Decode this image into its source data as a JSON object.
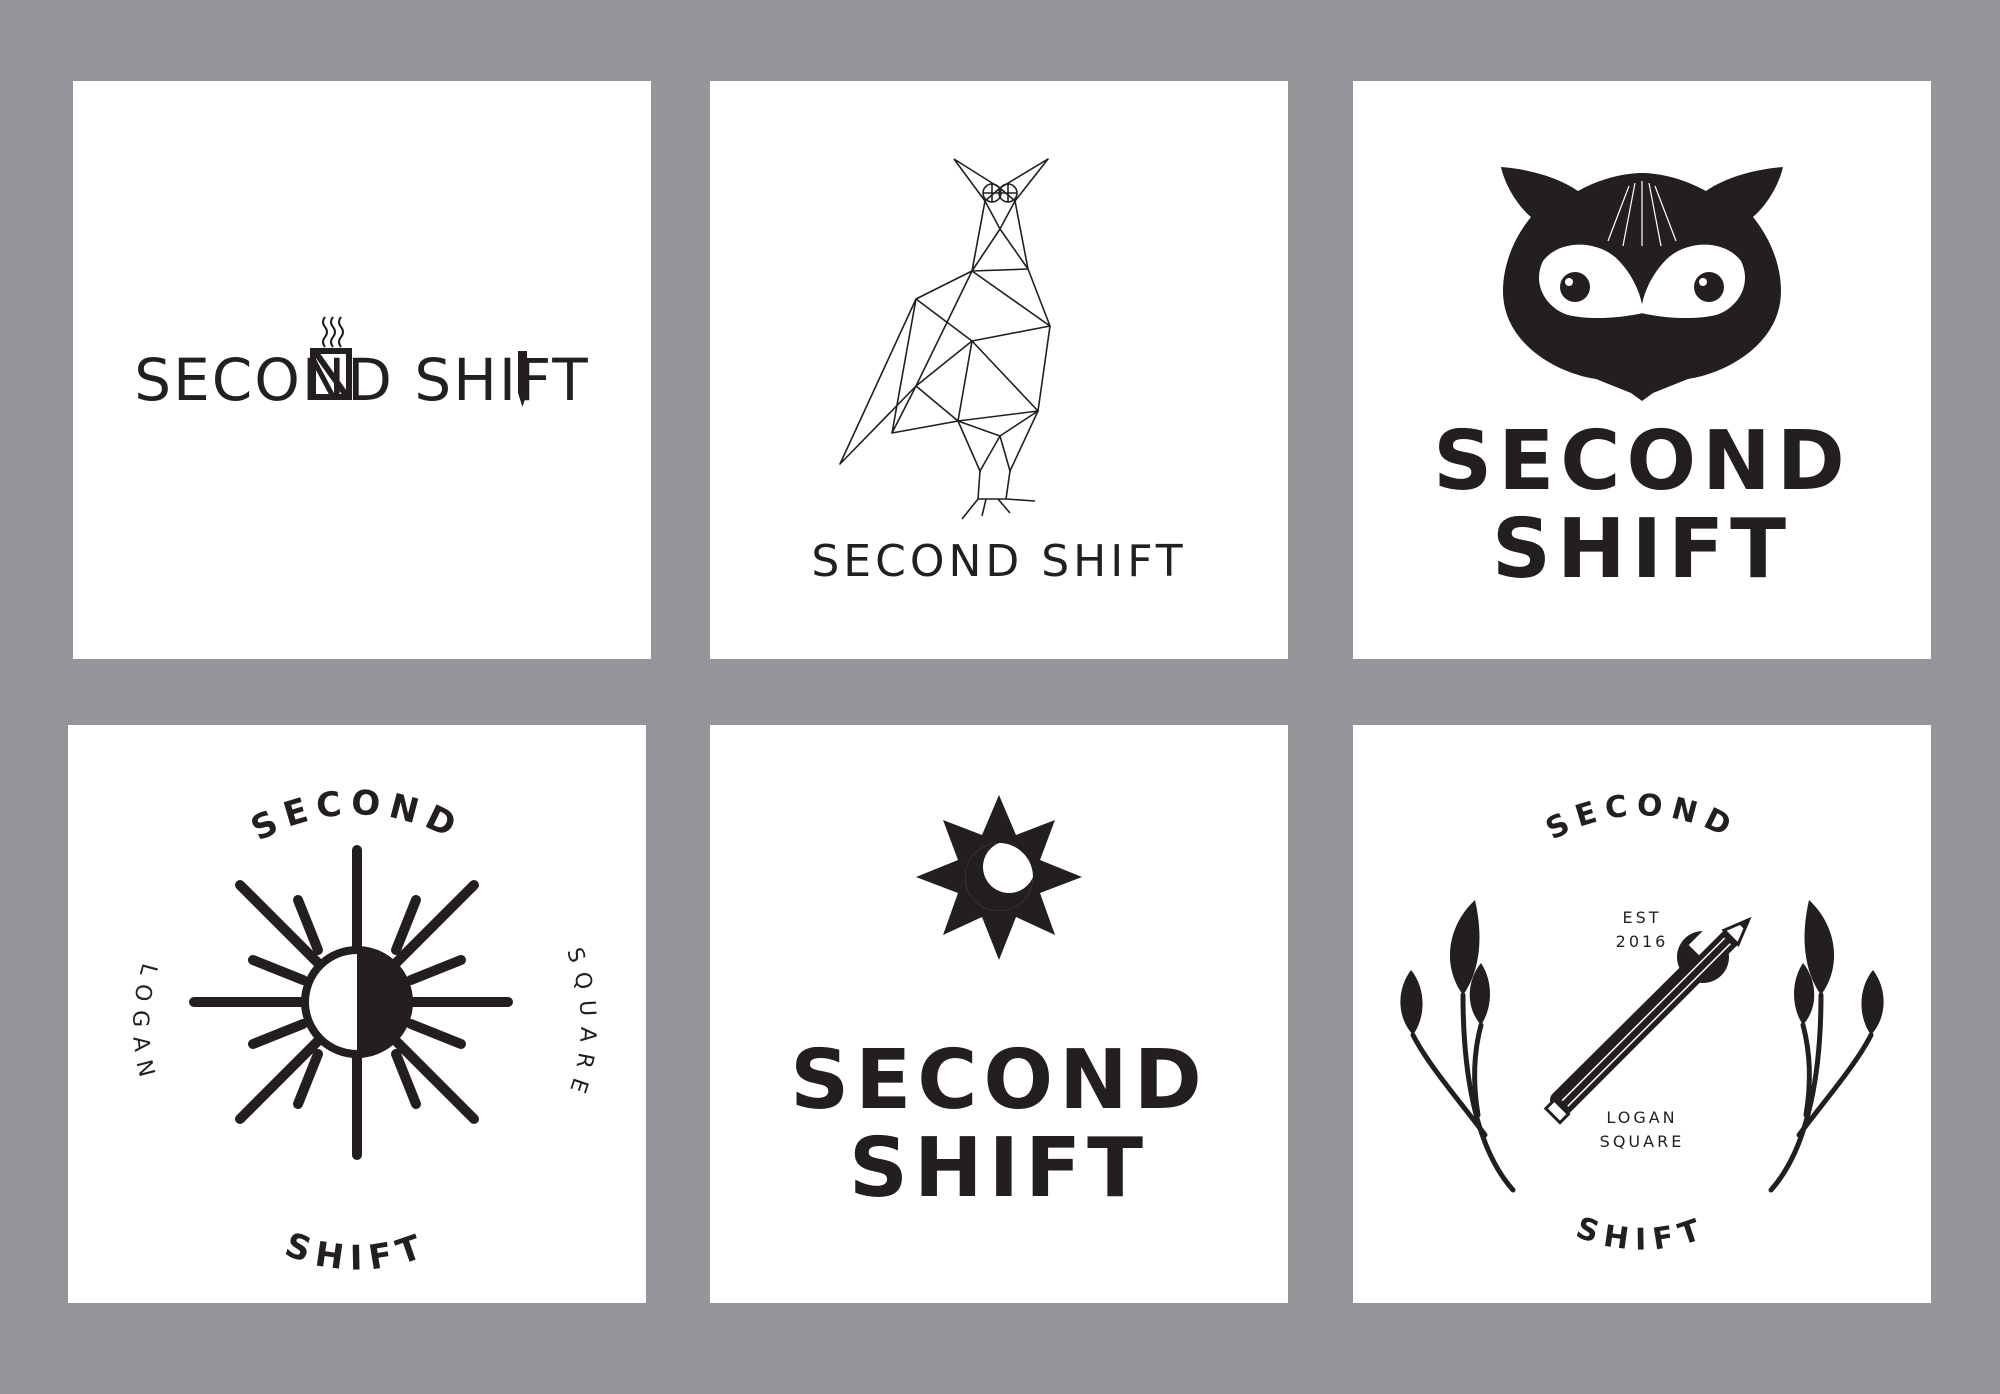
{
  "colors": {
    "background": "#939598",
    "card": "#ffffff",
    "ink": "#231f20"
  },
  "logos": [
    {
      "id": "logo-1",
      "style": "wordmark-with-mug-and-pencil",
      "wordmark": "SECOND SHIFT"
    },
    {
      "id": "logo-2",
      "style": "geometric-owl-line-art",
      "wordmark": "SECOND SHIFT"
    },
    {
      "id": "logo-3",
      "style": "owl-head",
      "line1": "SECOND",
      "line2": "SHIFT"
    },
    {
      "id": "logo-4",
      "style": "sun-badge",
      "top": "SECOND",
      "bottom": "SHIFT",
      "left": "LOGAN",
      "right": "SQUARE"
    },
    {
      "id": "logo-5",
      "style": "compass-star-moon",
      "line1": "SECOND",
      "line2": "SHIFT"
    },
    {
      "id": "logo-6",
      "style": "crossed-pencil-wrench-badge",
      "top": "SECOND",
      "bottom": "SHIFT",
      "est": "EST",
      "year": "2016",
      "loc1": "LOGAN",
      "loc2": "SQUARE"
    }
  ]
}
